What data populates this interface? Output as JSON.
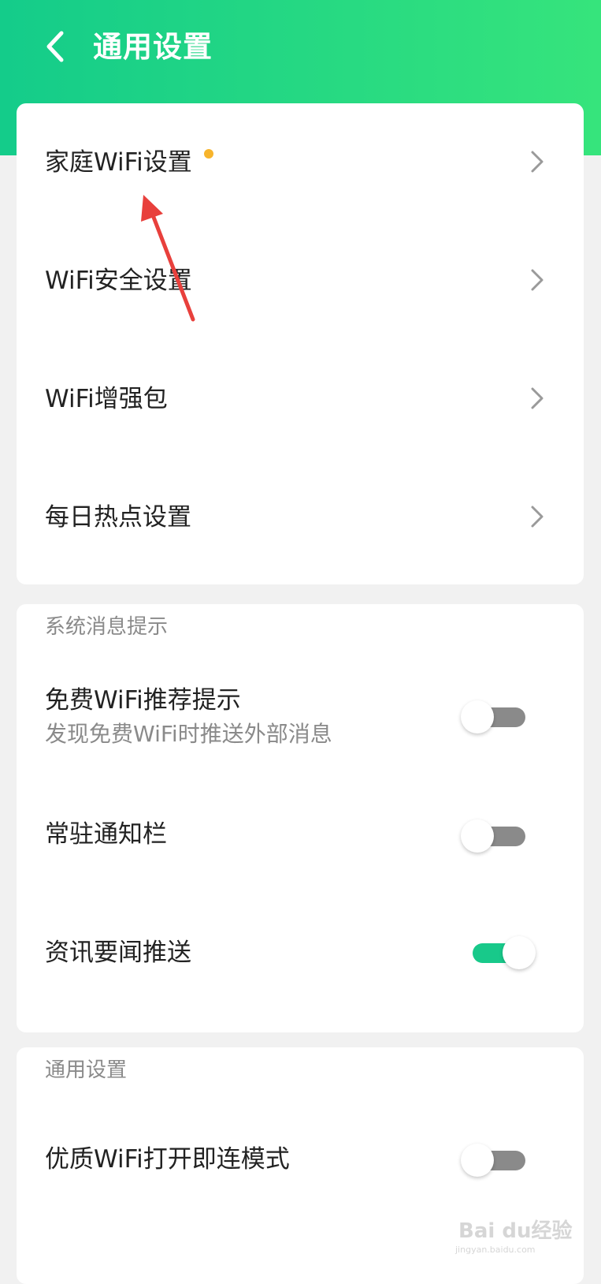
{
  "header": {
    "title": "通用设置",
    "back_icon": "chevron-left-icon",
    "gradient_start": "#14cc8a",
    "gradient_end": "#36e47c"
  },
  "menu_rows": [
    {
      "label": "家庭WiFi设置",
      "badge_dot": true,
      "badge_color": "#f7b42c",
      "icon": "chevron-right-icon"
    },
    {
      "label": "WiFi安全设置",
      "icon": "chevron-right-icon"
    },
    {
      "label": "WiFi增强包",
      "icon": "chevron-right-icon"
    },
    {
      "label": "每日热点设置",
      "icon": "chevron-right-icon"
    }
  ],
  "system_messages": {
    "section_title": "系统消息提示",
    "items": [
      {
        "label": "免费WiFi推荐提示",
        "sublabel": "发现免费WiFi时推送外部消息",
        "enabled": false
      },
      {
        "label": "常驻通知栏",
        "enabled": false
      },
      {
        "label": "资讯要闻推送",
        "enabled": true
      }
    ]
  },
  "general": {
    "section_title": "通用设置",
    "items": [
      {
        "label": "优质WiFi打开即连模式",
        "enabled": false
      }
    ]
  },
  "annotation": {
    "icon": "red-arrow-annotation",
    "color": "#e8403c"
  },
  "watermark": {
    "text": "Bai du经验",
    "subtext": "jingyan.baidu.com"
  }
}
